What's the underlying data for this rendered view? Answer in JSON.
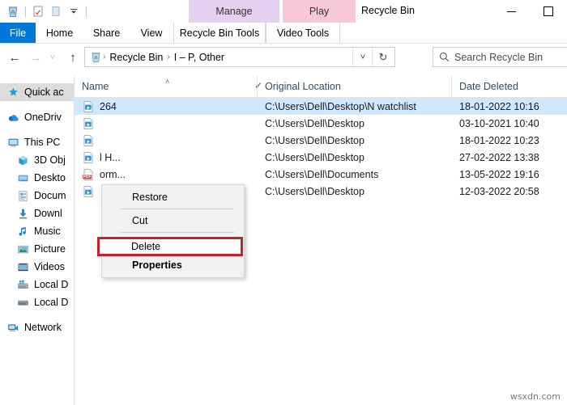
{
  "window": {
    "title": "Recycle Bin",
    "quick_access_toolbar": [
      {
        "name": "recycle-bin-icon",
        "label": "Recycle Bin Properties"
      },
      {
        "name": "properties-icon",
        "label": "Properties"
      },
      {
        "name": "new-folder-icon",
        "label": "New folder"
      },
      {
        "name": "customize-chevron-icon",
        "label": "Customize Quick Access Toolbar"
      }
    ],
    "controls": {
      "minimize": "Minimize",
      "maximize": "Maximize"
    }
  },
  "ribbon": {
    "context_tabs": [
      {
        "label": "Manage",
        "sub": "Recycle Bin Tools",
        "color": "#e4d1f0"
      },
      {
        "label": "Play",
        "sub": "Video Tools",
        "color": "#f7c9d8"
      }
    ],
    "tabs": [
      {
        "label": "File",
        "active": true
      },
      {
        "label": "Home",
        "active": false
      },
      {
        "label": "Share",
        "active": false
      },
      {
        "label": "View",
        "active": false
      }
    ],
    "tool_tabs": [
      {
        "label": "Recycle Bin Tools"
      },
      {
        "label": "Video Tools"
      }
    ]
  },
  "navbar": {
    "back": "←",
    "forward": "→",
    "recent": "˅",
    "up": "↑",
    "breadcrumb": {
      "icon": "recycle-bin-icon",
      "items": [
        "Recycle Bin",
        "I – P, Other"
      ],
      "separator": "›"
    },
    "dropdown": "˅",
    "refresh": "↻",
    "search": {
      "placeholder": "Search Recycle Bin",
      "value": ""
    }
  },
  "sidebar": {
    "items": [
      {
        "label": "Quick ac",
        "icon": "star-pin-icon",
        "selected": true,
        "indent": 0
      },
      {
        "label": "OneDriv",
        "icon": "onedrive-cloud-icon",
        "selected": false,
        "indent": 0
      },
      {
        "label": "This PC",
        "icon": "monitor-icon",
        "selected": false,
        "indent": 0
      },
      {
        "label": "3D Obj",
        "icon": "3d-objects-icon",
        "selected": false,
        "indent": 1
      },
      {
        "label": "Deskto",
        "icon": "desktop-icon",
        "selected": false,
        "indent": 1
      },
      {
        "label": "Docum",
        "icon": "documents-icon",
        "selected": false,
        "indent": 1
      },
      {
        "label": "Downl",
        "icon": "downloads-icon",
        "selected": false,
        "indent": 1
      },
      {
        "label": "Music",
        "icon": "music-note-icon",
        "selected": false,
        "indent": 1
      },
      {
        "label": "Picture",
        "icon": "pictures-icon",
        "selected": false,
        "indent": 1
      },
      {
        "label": "Videos",
        "icon": "videos-icon",
        "selected": false,
        "indent": 1
      },
      {
        "label": "Local D",
        "icon": "local-disk-windows-icon",
        "selected": false,
        "indent": 1
      },
      {
        "label": "Local D",
        "icon": "local-disk-icon",
        "selected": false,
        "indent": 1
      },
      {
        "label": "Network",
        "icon": "network-icon",
        "selected": false,
        "indent": 0
      }
    ]
  },
  "file_list": {
    "columns": [
      {
        "label": "Name",
        "sort_caret": "˄"
      },
      {
        "label": "Original Location",
        "check": "✓"
      },
      {
        "label": "Date Deleted"
      }
    ],
    "rows": [
      {
        "name": "264",
        "icon": "video-file-icon",
        "location": "C:\\Users\\Dell\\Desktop\\N watchlist",
        "date": "18-01-2022 10:16",
        "selected": true
      },
      {
        "name": "",
        "icon": "video-file-icon",
        "location": "C:\\Users\\Dell\\Desktop",
        "date": "03-10-2021 10:40",
        "selected": false
      },
      {
        "name": "",
        "icon": "video-file-icon",
        "location": "C:\\Users\\Dell\\Desktop",
        "date": "18-01-2022 10:23",
        "selected": false
      },
      {
        "name": "l H...",
        "icon": "video-file-icon",
        "location": "C:\\Users\\Dell\\Desktop",
        "date": "27-02-2022 13:38",
        "selected": false
      },
      {
        "name": "orm...",
        "icon": "pdf-file-icon",
        "location": "C:\\Users\\Dell\\Documents",
        "date": "13-05-2022 19:16",
        "selected": false
      },
      {
        "name": "",
        "icon": "video-file-icon",
        "location": "C:\\Users\\Dell\\Desktop",
        "date": "12-03-2022 20:58",
        "selected": false
      }
    ]
  },
  "context_menu": {
    "items": [
      {
        "label": "Restore",
        "bold": false,
        "highlighted": false
      },
      {
        "label": "Cut",
        "bold": false,
        "highlighted": false
      },
      {
        "label": "Delete",
        "bold": false,
        "highlighted": true
      },
      {
        "label": "Properties",
        "bold": true,
        "highlighted": false
      }
    ],
    "highlight_color": "#cc2027"
  },
  "watermark": "wsxdn.com"
}
